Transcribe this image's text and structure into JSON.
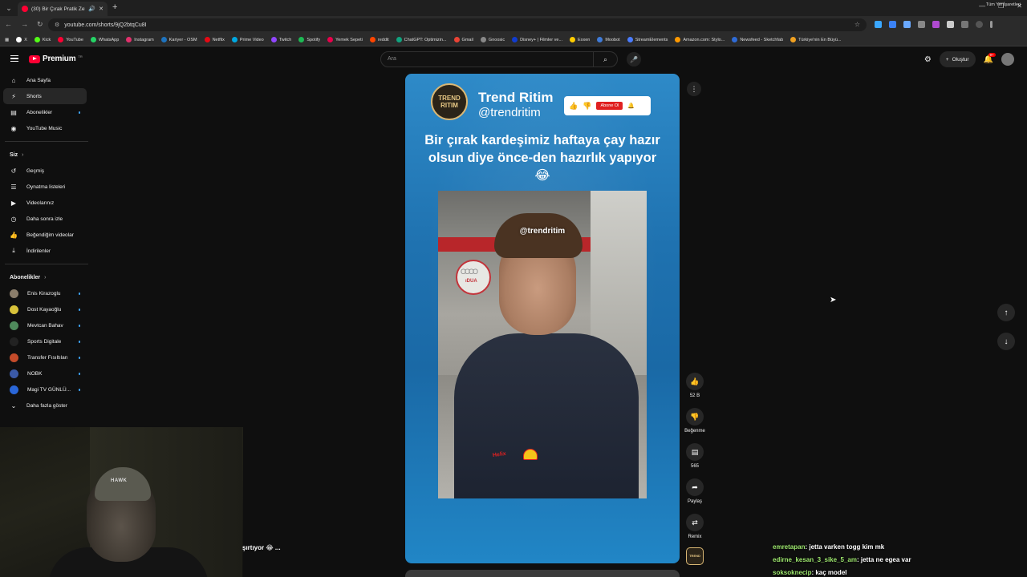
{
  "browser": {
    "tab_title": "(30) Bir Çırak Pratik Zekasıy",
    "url": "youtube.com/shorts/9jQ2btqCu8I",
    "bookmarks": [
      "X",
      "Kick",
      "YouTube",
      "WhatsApp",
      "Instagram",
      "Kariyer - OSM",
      "Netflix",
      "Prime Video",
      "Twitch",
      "Spotify",
      "Yemek Sepeti",
      "reddit",
      "ChatGPT: Optimizin...",
      "Gmail",
      "Gnoosic",
      "Disney+ | Filmler ve...",
      "Exxen",
      "Moobot",
      "StreamElements",
      "Amazon.com: Stylo...",
      "Newsfeed - Sketchfab",
      "Türkiye'nin En Büyü..."
    ],
    "bookmark_colors": [
      "#ffffff",
      "#53fc18",
      "#ff0033",
      "#25d366",
      "#e1306c",
      "#1e73be",
      "#e50914",
      "#00a8e1",
      "#9146ff",
      "#1db954",
      "#ea004b",
      "#ff4500",
      "#10a37f",
      "#ea4335",
      "#888888",
      "#113ccf",
      "#ffcc00",
      "#3f7bd8",
      "#4a7cff",
      "#ff9900",
      "#2f6bd6",
      "#f0a020"
    ],
    "all_bookmarks": "Tüm Yer İşaretleri"
  },
  "header": {
    "logo_text": "Premium",
    "logo_sup": "TR",
    "search_placeholder": "Ara",
    "create_label": "Oluştur",
    "notif_count": "9+"
  },
  "sidebar": {
    "main": [
      {
        "label": "Ana Sayfa",
        "icon": "home-icon",
        "glyph": "⌂"
      },
      {
        "label": "Shorts",
        "icon": "shorts-icon",
        "glyph": "⚡"
      },
      {
        "label": "Abonelikler",
        "icon": "subscriptions-icon",
        "glyph": "▤"
      },
      {
        "label": "YouTube Music",
        "icon": "music-icon",
        "glyph": "◉"
      }
    ],
    "you_heading": "Siz",
    "you": [
      {
        "label": "Geçmiş",
        "icon": "history-icon",
        "glyph": "↺"
      },
      {
        "label": "Oynatma listeleri",
        "icon": "playlists-icon",
        "glyph": "☰"
      },
      {
        "label": "Videolarınız",
        "icon": "your-videos-icon",
        "glyph": "▶"
      },
      {
        "label": "Daha sonra izle",
        "icon": "watch-later-icon",
        "glyph": "◷"
      },
      {
        "label": "Beğendiğim videolar",
        "icon": "liked-icon",
        "glyph": "👍"
      },
      {
        "label": "İndirilenler",
        "icon": "download-icon",
        "glyph": "⤓"
      }
    ],
    "subs_heading": "Abonelikler",
    "subscriptions": [
      {
        "label": "Enis Kirazoglu",
        "color": "#8a7d6a"
      },
      {
        "label": "Dost Kayaoğlu",
        "color": "#d8c23a"
      },
      {
        "label": "Mevtcan Bahav",
        "color": "#4f8a5c"
      },
      {
        "label": "Sports Digitale",
        "color": "#222222"
      },
      {
        "label": "Transfer Fısıltıları",
        "color": "#c44b2a"
      },
      {
        "label": "NOBK",
        "color": "#3b5aa8"
      },
      {
        "label": "Magi TV GÜNLÜ...",
        "color": "#2a66d8"
      }
    ],
    "show_more": "Daha fazla göster"
  },
  "short": {
    "channel_logo": [
      "TREND",
      "RITIM"
    ],
    "channel_name": "Trend Ritim",
    "channel_handle": "@trendritim",
    "subscribe_label": "Abone Ol",
    "caption": "Bir çırak kardeşimiz haftaya çay hazır olsun diye önce-den hazırlık yapıyor 😂",
    "watermark": "@trendritim",
    "sign_text": "ıDUA",
    "jacket_text": "Helix"
  },
  "actions": {
    "likes": "52 B",
    "dislike_label": "Beğenme",
    "comments": "565",
    "share_label": "Paylaş",
    "remix_label": "Remix"
  },
  "overlay": {
    "partial_text": "şırtıyor 😂 ...",
    "cam_cap_text": "HAWK"
  },
  "chat": [
    {
      "user": "emretapan",
      "text": ": jetta varken togg kim mk"
    },
    {
      "user": "edirne_kesan_3_sike_5_am",
      "text": ": jetta ne egea var"
    },
    {
      "user": "soksoknecip",
      "text": ": kaç model"
    }
  ]
}
